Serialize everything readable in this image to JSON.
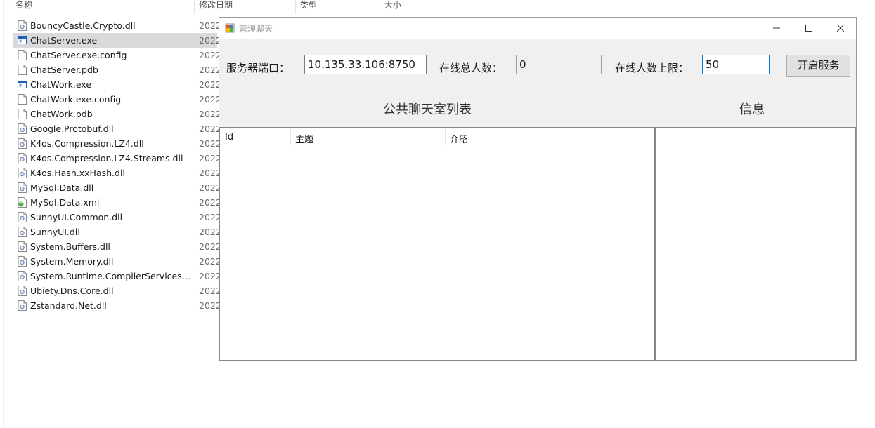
{
  "explorer": {
    "columns": {
      "name": "名称",
      "modified": "修改日期",
      "type": "类型",
      "size": "大小"
    },
    "files": [
      {
        "name": "BouncyCastle.Crypto.dll",
        "date": "2022",
        "icon": "dll-file-icon"
      },
      {
        "name": "ChatServer.exe",
        "date": "2022",
        "icon": "exe-file-icon"
      },
      {
        "name": "ChatServer.exe.config",
        "date": "2022",
        "icon": "generic-file-icon"
      },
      {
        "name": "ChatServer.pdb",
        "date": "2022",
        "icon": "generic-file-icon"
      },
      {
        "name": "ChatWork.exe",
        "date": "2022",
        "icon": "exe-file-icon"
      },
      {
        "name": "ChatWork.exe.config",
        "date": "2022",
        "icon": "generic-file-icon"
      },
      {
        "name": "ChatWork.pdb",
        "date": "2022",
        "icon": "generic-file-icon"
      },
      {
        "name": "Google.Protobuf.dll",
        "date": "2022",
        "icon": "dll-file-icon"
      },
      {
        "name": "K4os.Compression.LZ4.dll",
        "date": "2022",
        "icon": "dll-file-icon"
      },
      {
        "name": "K4os.Compression.LZ4.Streams.dll",
        "date": "2022",
        "icon": "dll-file-icon"
      },
      {
        "name": "K4os.Hash.xxHash.dll",
        "date": "2022",
        "icon": "dll-file-icon"
      },
      {
        "name": "MySql.Data.dll",
        "date": "2022",
        "icon": "dll-file-icon"
      },
      {
        "name": "MySql.Data.xml",
        "date": "2022",
        "icon": "xml-file-icon"
      },
      {
        "name": "SunnyUI.Common.dll",
        "date": "2022",
        "icon": "dll-file-icon"
      },
      {
        "name": "SunnyUI.dll",
        "date": "2022",
        "icon": "dll-file-icon"
      },
      {
        "name": "System.Buffers.dll",
        "date": "2022",
        "icon": "dll-file-icon"
      },
      {
        "name": "System.Memory.dll",
        "date": "2022",
        "icon": "dll-file-icon"
      },
      {
        "name": "System.Runtime.CompilerServices.Un...",
        "date": "2022",
        "icon": "dll-file-icon"
      },
      {
        "name": "Ubiety.Dns.Core.dll",
        "date": "2022",
        "icon": "dll-file-icon"
      },
      {
        "name": "Zstandard.Net.dll",
        "date": "2022",
        "icon": "dll-file-icon"
      }
    ],
    "selected_file": "ChatServer.exe"
  },
  "window": {
    "title": "管理聊天",
    "server_port_label": "服务器端口：",
    "server_port_value": "10.135.33.106:8750",
    "online_total_label": "在线总人数：",
    "online_total_value": "0",
    "online_limit_label": "在线人数上限：",
    "online_limit_value": "50",
    "start_button": "开启服务",
    "rooms_title": "公共聊天室列表",
    "info_title": "信息",
    "list_columns": [
      "Id",
      "主题",
      "介绍"
    ]
  },
  "colors": {
    "window_bg": "#f0f0f0",
    "selection_bg": "#d9d9d9",
    "focus_border": "#0078d7",
    "exe_icon_blue": "#1f5fbf"
  }
}
